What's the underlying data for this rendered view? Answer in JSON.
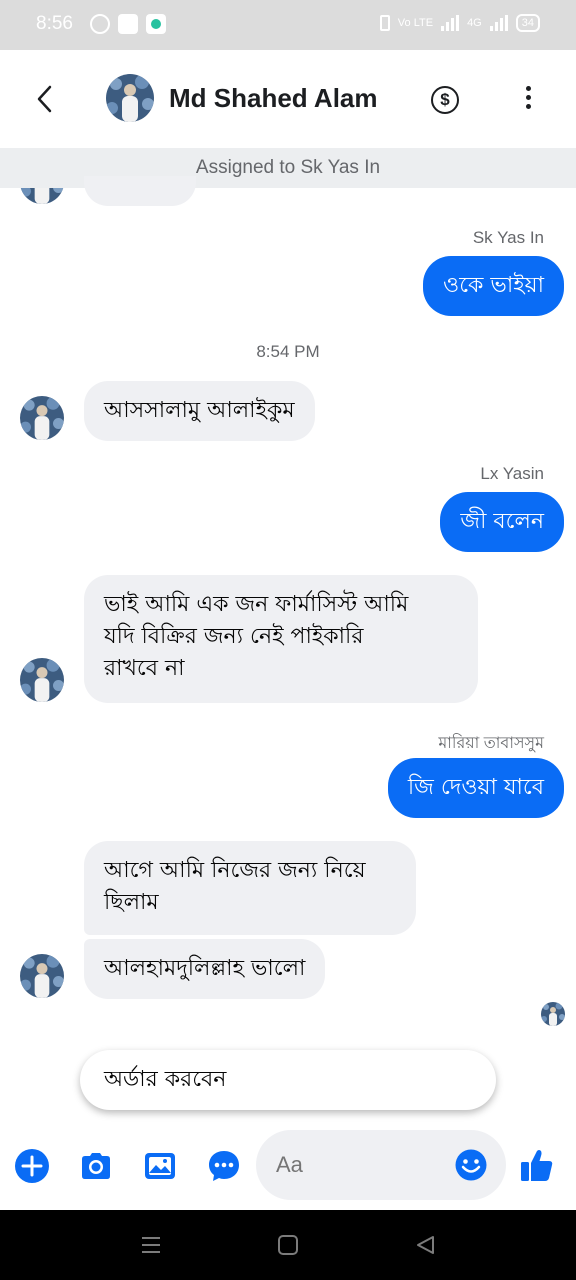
{
  "status_bar": {
    "time": "8:56",
    "battery": "34",
    "network_label": "Vo LTE",
    "signal_label": "4G"
  },
  "header": {
    "contact_name": "Md Shahed Alam",
    "dollar_symbol": "$"
  },
  "assigned_text": "Assigned to Sk Yas In",
  "messages": {
    "m1_sender": "Sk Yas In",
    "m1_text": "ওকে ভাইয়া",
    "timestamp": "8:54 PM",
    "m2_text": "আসসালামু আলাইকুম",
    "m3_sender": "Lx Yasin",
    "m3_text": "জী  বলেন",
    "m4_line1": "ভাই আমি এক জন ফার্মাসিস্ট আমি",
    "m4_line2": "যদি বিক্রির জন্য নেই পাইকারি",
    "m4_line3": "রাখবে না",
    "m5_sender": "মারিয়া তাবাসসুম",
    "m5_text": "জি দেওয়া যাবে",
    "m6_line1": "আগে আমি নিজের জন্য নিয়ে",
    "m6_line2": "ছিলাম",
    "m7_text": "আলহামদুলিল্লাহ ভালো"
  },
  "suggestion": "অর্ডার করবেন",
  "composer": {
    "placeholder": "Aa"
  },
  "colors": {
    "accent": "#0a6cf5",
    "incoming_bubble": "#eff0f3",
    "assigned_bar": "#eceef0"
  },
  "icons": [
    "back-arrow-icon",
    "dollar-icon",
    "more-icon",
    "plus-icon",
    "camera-icon",
    "gallery-icon",
    "more-actions-icon",
    "emoji-icon",
    "like-icon",
    "nav-menu-icon",
    "nav-home-icon",
    "nav-back-icon"
  ]
}
